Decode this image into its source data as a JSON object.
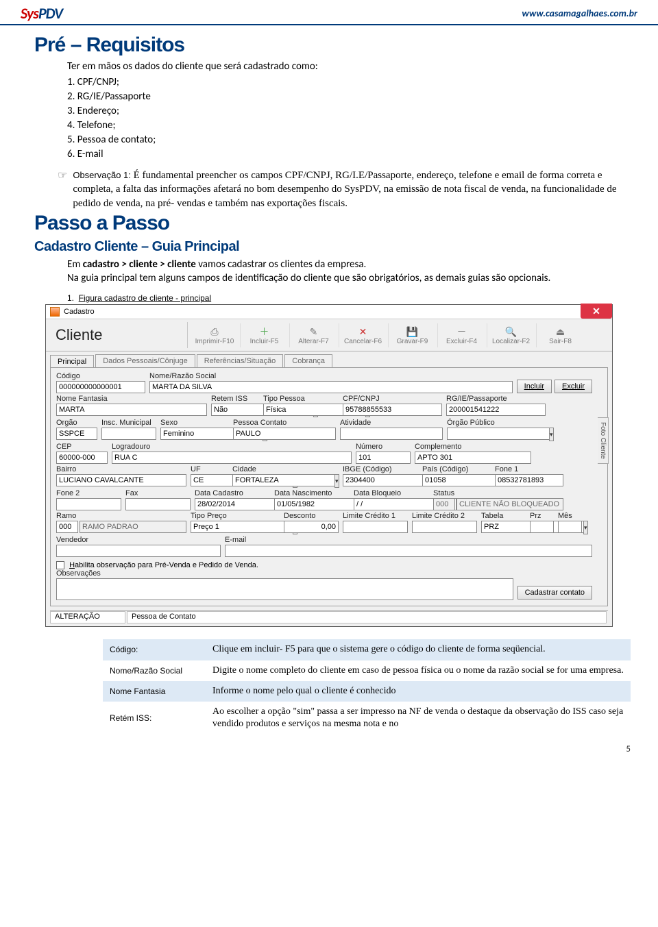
{
  "header": {
    "logo_sys": "Sys",
    "logo_pdv": "PDV",
    "url": "www.casamagalhaes.com.br"
  },
  "h1_pre": "Pré – Requisitos",
  "intro_lead": "Ter em mãos os dados do cliente que será cadastrado como:",
  "intro_items": {
    "i1": "1.   CPF/CNPJ;",
    "i2": "2.   RG/IE/Passaporte",
    "i3": "3.   Endereço;",
    "i4": "4.   Telefone;",
    "i5": "5.   Pessoa de contato;",
    "i6": "6.   E-mail"
  },
  "obs_label": "Observação 1:",
  "obs_text": " É fundamental preencher os campos CPF/CNPJ, RG/I.E/Passaporte, endereço, telefone e email de forma correta e completa, a falta das informações afetará no bom desempenho do SysPDV, na emissão de nota fiscal de venda, na  funcionalidade  de pedido de venda, na pré- vendas e também nas exportações fiscais.",
  "h1_passo": "Passo a Passo",
  "h2_guia": "Cadastro Cliente – Guia Principal",
  "p_em": "Em ",
  "p_em_bold": "cadastro > cliente > cliente",
  "p_em_rest": " vamos cadastrar os clientes da empresa.",
  "p_guia_rest": "Na guia principal tem alguns campos de identificação do cliente que são obrigatórios, as demais guias são opcionais.",
  "fig_cap_num": "1.",
  "fig_cap": "Figura cadastro de cliente - principal",
  "window": {
    "title": "Cadastro",
    "name": "Cliente",
    "toolbar": {
      "print": "Imprimir-F10",
      "include": "Incluir-F5",
      "alter": "Alterar-F7",
      "cancel": "Cancelar-F6",
      "save": "Gravar-F9",
      "delete": "Excluir-F4",
      "locate": "Localizar-F2",
      "exit": "Sair-F8"
    },
    "tabs": {
      "t1": "Principal",
      "t2": "Dados Pessoais/Cônjuge",
      "t3": "Referências/Situação",
      "t4": "Cobrança"
    },
    "btn_incluir": "Incluir",
    "btn_excluir": "Excluir",
    "btn_cadcont": "Cadastrar contato",
    "labels": {
      "codigo": "Código",
      "nome": "Nome/Razão Social",
      "fantasia": "Nome Fantasia",
      "retem": "Retem ISS",
      "tipopessoa": "Tipo Pessoa",
      "cpf": "CPF/CNPJ",
      "rgie": "RG/IE/Passaporte",
      "orgao": "Orgão",
      "inscm": "Insc. Municipal",
      "sexo": "Sexo",
      "pcontato": "Pessoa  Contato",
      "atividade": "Atividade",
      "orgpub": "Órgão Público",
      "cep": "CEP",
      "logr": "Logradouro",
      "numero": "Número",
      "compl": "Complemento",
      "bairro": "Bairro",
      "uf": "UF",
      "cidade": "Cidade",
      "ibge": "IBGE (Código)",
      "pais": "País (Código)",
      "fone1": "Fone 1",
      "fone2": "Fone 2",
      "fax": "Fax",
      "dtcad": "Data Cadastro",
      "dtnasc": "Data Nascimento",
      "dtbloq": "Data Bloqueio",
      "status": "Status",
      "ramo": "Ramo",
      "tpreco": "Tipo Preço",
      "desc": "Desconto",
      "lim1": "Limite Crédito 1",
      "lim2": "Limite Crédito 2",
      "tabela": "Tabela",
      "prz": "Prz",
      "mes": "Mês",
      "vendedor": "Vendedor",
      "email": "E-mail",
      "hab": "Habilita observação para Pré-Venda e Pedido de Venda.",
      "observ": "Observações"
    },
    "values": {
      "codigo": "000000000000001",
      "nome": "MARTA DA SILVA",
      "fantasia": "MARTA",
      "retem": "Não",
      "tipopessoa": "Física",
      "cpf": "95788855533",
      "rgie": "200001541222",
      "orgao": "SSPCE",
      "sexo": "Feminino",
      "pcontato": "PAULO",
      "cep": "60000-000",
      "logr": "RUA C",
      "numero": "101",
      "compl": "APTO 301",
      "bairro": "LUCIANO CAVALCANTE",
      "uf": "CE",
      "cidade": "FORTALEZA",
      "ibge": "2304400",
      "pais": "01058",
      "fone1": "08532781893",
      "dtcad": "28/02/2014",
      "dtnasc": "01/05/1982",
      "dtbloq": "/ /",
      "status_code": "000",
      "status_txt": "CLIENTE NÃO BLOQUEADO",
      "ramo_code": "000",
      "ramo_txt": "RAMO PADRAO",
      "tpreco": "Preço 1",
      "desc": "0,00",
      "tabela": "PRZ"
    },
    "side": {
      "foto": "Foto Cliente"
    },
    "status": {
      "mode": "ALTERAÇÃO",
      "sub": "Pessoa de Contato"
    }
  },
  "defs": {
    "k1": "Código:",
    "v1": "Clique em incluir- F5 para que o sistema gere o código do cliente de forma seqüencial.",
    "k2": "Nome/Razão Social",
    "v2": "Digite o nome completo do cliente em caso de pessoa física ou o nome da razão social se for uma empresa.",
    "k3": "Nome Fantasia",
    "v3": "Informe o nome pelo qual o cliente é conhecido",
    "k4": "Retém ISS:",
    "v4": "Ao escolher a opção \"sim\" passa a ser impresso na NF de venda o destaque da observação do ISS caso seja vendido produtos e serviços na mesma nota e no"
  },
  "pagenum": "5"
}
